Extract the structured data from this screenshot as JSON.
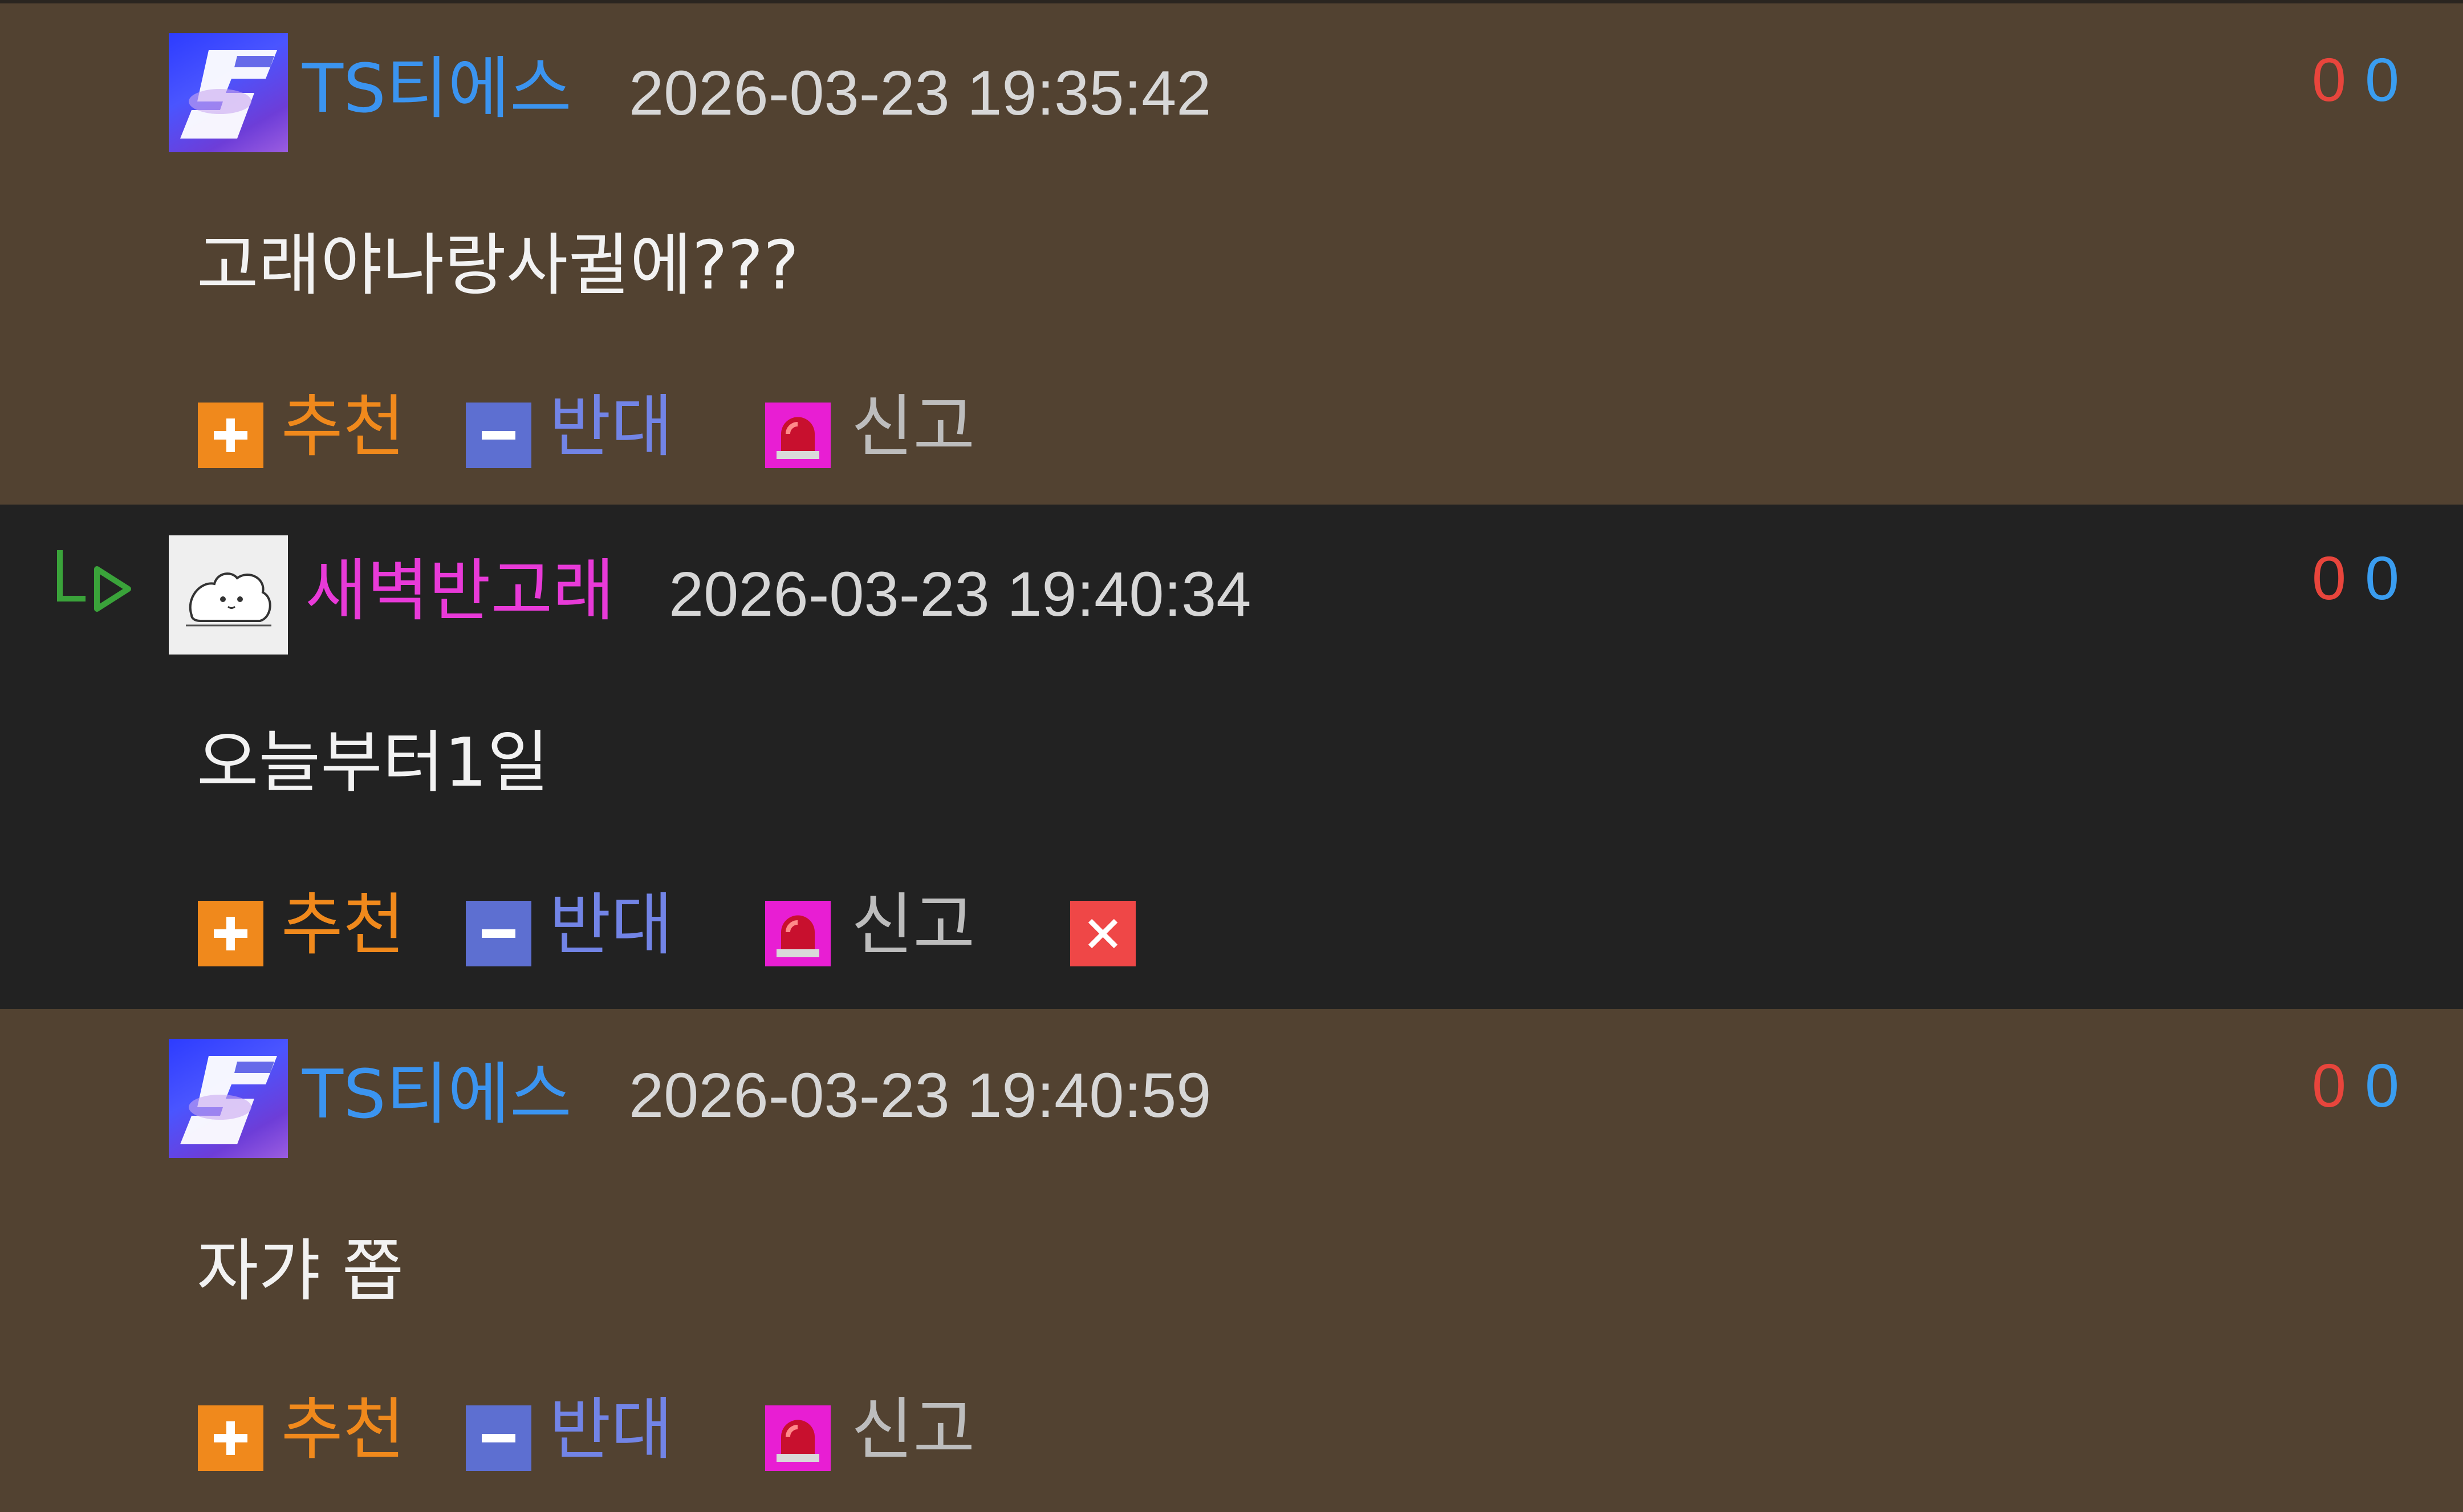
{
  "comments": [
    {
      "username": "TS티에스",
      "timestamp": "2026-03-23 19:35:42",
      "upvotes": "0",
      "downvotes": "0",
      "text": "고래야나랑사귈에???",
      "actions": {
        "recommend": "추천",
        "oppose": "반대",
        "report": "신고"
      }
    },
    {
      "username": "새벽반고래",
      "timestamp": "2026-03-23 19:40:34",
      "upvotes": "0",
      "downvotes": "0",
      "text": "오늘부터1일",
      "is_reply": true,
      "actions": {
        "recommend": "추천",
        "oppose": "반대",
        "report": "신고"
      }
    },
    {
      "username": "TS티에스",
      "timestamp": "2026-03-23 19:40:59",
      "upvotes": "0",
      "downvotes": "0",
      "text": "자갸 쫍",
      "actions": {
        "recommend": "추천",
        "oppose": "반대",
        "report": "신고"
      }
    }
  ],
  "colors": {
    "comment_bg_brown": "#524231",
    "comment_bg_dark": "#222222",
    "username_blue": "#3b94f0",
    "username_pink": "#e83ad8",
    "upvote_red": "#e8453c",
    "downvote_blue": "#3a9df0",
    "recommend_orange": "#f0891c",
    "oppose_blue": "#5d6fd1",
    "report_magenta": "#e81ed3",
    "delete_red": "#ef4747"
  },
  "icons": {
    "reply": "reply-arrow-icon",
    "recommend": "plus-icon",
    "oppose": "minus-icon",
    "report": "siren-icon",
    "delete": "close-icon"
  }
}
